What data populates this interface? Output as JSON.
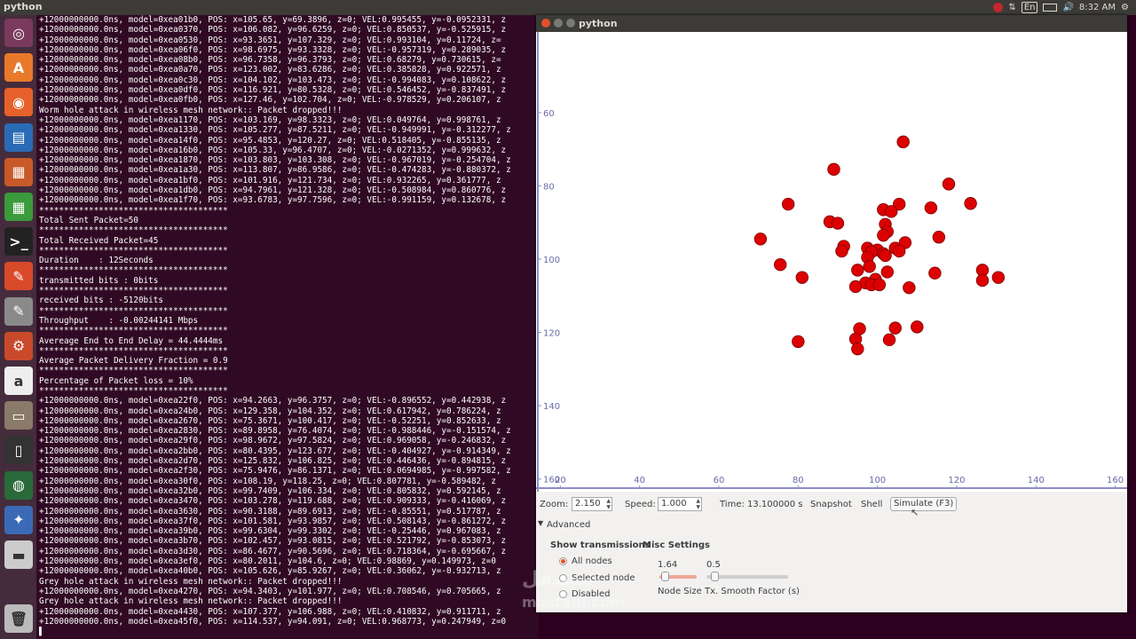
{
  "topbar": {
    "title": "python",
    "lang": "En",
    "time": "8:32 AM"
  },
  "launcher": {
    "items": [
      {
        "name": "ubuntu-dash-icon",
        "color": "#7a3a5e",
        "glyph": "◎"
      },
      {
        "name": "software-center-icon",
        "color": "#e9792a",
        "glyph": "A"
      },
      {
        "name": "firefox-icon",
        "color": "#e6612b",
        "glyph": "◉"
      },
      {
        "name": "writer-icon",
        "color": "#2a6bb5",
        "glyph": "▤"
      },
      {
        "name": "impress-icon",
        "color": "#c85a2a",
        "glyph": "▦"
      },
      {
        "name": "calc-icon",
        "color": "#3b9a3b",
        "glyph": "▦"
      },
      {
        "name": "terminal-icon",
        "color": "#222222",
        "glyph": ">_"
      },
      {
        "name": "editor-icon",
        "color": "#d84a2a",
        "glyph": "✎"
      },
      {
        "name": "text-editor-icon",
        "color": "#8a8a8a",
        "glyph": "✎"
      },
      {
        "name": "settings-icon",
        "color": "#c94a2a",
        "glyph": "⚙"
      },
      {
        "name": "amazon-icon",
        "color": "#eeeeee",
        "glyph": "a"
      },
      {
        "name": "files-icon",
        "color": "#8a7a6a",
        "glyph": "▭"
      },
      {
        "name": "usb-icon",
        "color": "#333333",
        "glyph": "▯"
      },
      {
        "name": "globe-icon",
        "color": "#2a6a3a",
        "glyph": "◍"
      },
      {
        "name": "python-icon",
        "color": "#3a6ab5",
        "glyph": "✦"
      },
      {
        "name": "drive-icon",
        "color": "#cccccc",
        "glyph": "▬"
      }
    ],
    "trash": {
      "name": "trash-icon",
      "color": "#bbbbbb",
      "glyph": "🗑"
    }
  },
  "terminal": {
    "lines": [
      "+12000000000.0ns, model=0xea01b0, POS: x=105.65, y=69.3896, z=0; VEL:0.995455, y=-0.0952331, z",
      "+12000000000.0ns, model=0xea0370, POS: x=106.082, y=96.6259, z=0; VEL:0.850537, y=-0.525915, z",
      "+12000000000.0ns, model=0xea0530, POS: x=93.3651, y=107.329, z=0; VEL:0.993104, y=0.11724, z=",
      "+12000000000.0ns, model=0xea06f0, POS: x=98.6975, y=93.3328, z=0; VEL:-0.957319, y=0.289035, z",
      "+12000000000.0ns, model=0xea08b0, POS: x=96.7358, y=96.3793, z=0; VEL:0.68279, y=0.730615, z=",
      "+12000000000.0ns, model=0xea0a70, POS: x=123.002, y=83.6286, z=0; VEL:0.385828, y=0.922571, z",
      "+12000000000.0ns, model=0xea0c30, POS: x=104.102, y=103.473, z=0; VEL:-0.994083, y=0.108622, z",
      "+12000000000.0ns, model=0xea0df0, POS: x=116.921, y=80.5328, z=0; VEL:0.546452, y=-0.837491, z",
      "+12000000000.0ns, model=0xea0fb0, POS: x=127.46, y=102.704, z=0; VEL:-0.978529, y=0.206107, z",
      "Worm hole attack in wireless mesh network:: Packet dropped!!!",
      "+12000000000.0ns, model=0xea1170, POS: x=103.169, y=98.3323, z=0; VEL:0.049764, y=0.998761, z",
      "+12000000000.0ns, model=0xea1330, POS: x=105.277, y=87.5211, z=0; VEL:-0.949991, y=-0.312277, z",
      "+12000000000.0ns, model=0xea14f0, POS: x=95.4853, y=120.27, z=0; VEL:0.518405, y=-0.855135, z",
      "+12000000000.0ns, model=0xea16b0, POS: x=105.33, y=96.4707, z=0; VEL:-0.0271352, y=0.999632, z",
      "+12000000000.0ns, model=0xea1870, POS: x=103.803, y=103.308, z=0; VEL:-0.967019, y=-0.254704, z",
      "+12000000000.0ns, model=0xea1a30, POS: x=113.807, y=86.9586, z=0; VEL:-0.474283, y=-0.880372, z",
      "+12000000000.0ns, model=0xea1bf0, POS: x=101.916, y=121.734, z=0; VEL:0.932265, y=0.361777, z",
      "+12000000000.0ns, model=0xea1db0, POS: x=94.7961, y=121.328, z=0; VEL:-0.508984, y=0.860776, z",
      "+12000000000.0ns, model=0xea1f70, POS: x=93.6783, y=97.7596, z=0; VEL:-0.991159, y=0.132678, z",
      "**************************************",
      "Total Sent Packet=50",
      "**************************************",
      "Total Received Packet=45",
      "**************************************",
      "Duration    : 12Seconds",
      "**************************************",
      "transmitted bits : 0bits",
      "**************************************",
      "received bits : -5120bits",
      "**************************************",
      "Throughput    : -0.00244141 Mbps",
      "**************************************",
      "Avereage End to End Delay = 44.4444ms",
      "**************************************",
      "Average Packet Delivery Fraction = 0.9",
      "**************************************",
      "Percentage of Packet loss = 10%",
      "**************************************",
      "+12000000000.0ns, model=0xea22f0, POS: x=94.2663, y=96.3757, z=0; VEL:-0.896552, y=0.442938, z",
      "+12000000000.0ns, model=0xea24b0, POS: x=129.358, y=104.352, z=0; VEL:0.617942, y=0.786224, z",
      "+12000000000.0ns, model=0xea2670, POS: x=75.3671, y=100.417, z=0; VEL:-0.52251, y=0.852633, z",
      "+12000000000.0ns, model=0xea2830, POS: x=89.8958, y=76.4074, z=0; VEL:-0.988446, y=-0.151574, z",
      "+12000000000.0ns, model=0xea29f0, POS: x=98.9672, y=97.5824, z=0; VEL:0.969058, y=-0.246832, z",
      "+12000000000.0ns, model=0xea2bb0, POS: x=80.4395, y=123.677, z=0; VEL:-0.404927, y=-0.914349, z",
      "+12000000000.0ns, model=0xea2d70, POS: x=125.832, y=106.825, z=0; VEL:0.446436, y=-0.894815, z",
      "+12000000000.0ns, model=0xea2f30, POS: x=75.9476, y=86.1371, z=0; VEL:0.0694985, y=-0.997582, z",
      "+12000000000.0ns, model=0xea30f0, POS: x=108.19, y=118.25, z=0; VEL:0.807781, y=-0.589482, z",
      "+12000000000.0ns, model=0xea32b0, POS: x=99.7409, y=106.334, z=0; VEL:0.805832, y=0.592145, z",
      "+12000000000.0ns, model=0xea3470, POS: x=103.278, y=119.688, z=0; VEL:0.909333, y=-0.416069, z",
      "+12000000000.0ns, model=0xea3630, POS: x=90.3188, y=89.6913, z=0; VEL:-0.85551, y=0.517787, z",
      "+12000000000.0ns, model=0xea37f0, POS: x=101.581, y=93.9857, z=0; VEL:0.508143, y=-0.861272, z",
      "+12000000000.0ns, model=0xea39b0, POS: x=99.6304, y=99.3302, z=0; VEL:-0.25446, y=0.967083, z",
      "+12000000000.0ns, model=0xea3b70, POS: x=102.457, y=93.0815, z=0; VEL:0.521792, y=-0.853073, z",
      "+12000000000.0ns, model=0xea3d30, POS: x=86.4677, y=90.5696, z=0; VEL:0.718364, y=-0.695667, z",
      "+12000000000.0ns, model=0xea3ef0, POS: x=80.2011, y=104.6, z=0; VEL:0.98869, y=0.149973, z=0",
      "+12000000000.0ns, model=0xea40b0, POS: x=105.626, y=85.9267, z=0; VEL:0.36062, y=-0.932713, z",
      "Grey hole attack in wireless mesh network:: Packet dropped!!!",
      "+12000000000.0ns, model=0xea4270, POS: x=94.3403, y=101.977, z=0; VEL:0.708546, y=0.705665, z",
      "Grey hole attack in wireless mesh network:: Packet dropped!!!",
      "+12000000000.0ns, model=0xea4430, POS: x=107.377, y=106.988, z=0; VEL:0.410832, y=0.911711, z",
      "+12000000000.0ns, model=0xea45f0, POS: x=114.537, y=94.091, z=0; VEL:0.968773, y=0.247949, z=0"
    ],
    "cursor": "▌"
  },
  "pywin": {
    "title": "python"
  },
  "chart_data": {
    "type": "scatter",
    "title": "",
    "xlabel": "",
    "ylabel": "",
    "xlim": [
      15,
      163
    ],
    "ylim": [
      38,
      162
    ],
    "x_ticks": [
      "20",
      "40",
      "60",
      "80",
      "100",
      "120",
      "140",
      "160"
    ],
    "x_tick_values": [
      20,
      40,
      60,
      80,
      100,
      120,
      140,
      160
    ],
    "y_ticks": [
      "60",
      "80",
      "100",
      "120",
      "140",
      "160"
    ],
    "y_tick_values": [
      60,
      80,
      100,
      120,
      140,
      160
    ],
    "y_inverted": true,
    "grid": false,
    "node_color": "#dd0000",
    "points": [
      [
        106.5,
        68.0
      ],
      [
        89.0,
        75.5
      ],
      [
        118.0,
        79.5
      ],
      [
        123.5,
        84.8
      ],
      [
        77.5,
        85.0
      ],
      [
        105.5,
        85.0
      ],
      [
        113.5,
        86.0
      ],
      [
        101.5,
        86.5
      ],
      [
        103.5,
        87.0
      ],
      [
        88.0,
        89.8
      ],
      [
        90.0,
        90.2
      ],
      [
        102.0,
        90.5
      ],
      [
        102.5,
        92.5
      ],
      [
        101.5,
        93.5
      ],
      [
        115.5,
        94.0
      ],
      [
        70.5,
        94.5
      ],
      [
        107.0,
        95.5
      ],
      [
        91.5,
        96.5
      ],
      [
        97.5,
        97.0
      ],
      [
        100.0,
        97.5
      ],
      [
        104.5,
        97.0
      ],
      [
        91.0,
        97.8
      ],
      [
        105.5,
        97.8
      ],
      [
        98.5,
        98.0
      ],
      [
        101.5,
        98.5
      ],
      [
        97.5,
        99.5
      ],
      [
        102.0,
        99.0
      ],
      [
        75.5,
        101.5
      ],
      [
        98.0,
        102.0
      ],
      [
        95.0,
        103.0
      ],
      [
        102.5,
        103.5
      ],
      [
        126.5,
        103.0
      ],
      [
        114.5,
        103.8
      ],
      [
        130.5,
        105.0
      ],
      [
        81.0,
        105.0
      ],
      [
        99.5,
        105.5
      ],
      [
        126.5,
        105.8
      ],
      [
        97.0,
        106.5
      ],
      [
        98.5,
        107.0
      ],
      [
        100.5,
        107.0
      ],
      [
        94.5,
        107.5
      ],
      [
        108.0,
        107.8
      ],
      [
        95.5,
        119.0
      ],
      [
        104.5,
        118.8
      ],
      [
        110.0,
        118.5
      ],
      [
        94.5,
        121.8
      ],
      [
        103.0,
        122.0
      ],
      [
        80.0,
        122.5
      ],
      [
        95.0,
        124.5
      ]
    ]
  },
  "controls": {
    "zoom_label": "Zoom:",
    "zoom_value": "2.150",
    "speed_label": "Speed:",
    "speed_value": "1.000",
    "time_text": "Time: 13.100000 s",
    "snapshot_label": "Snapshot",
    "shell_label": "Shell",
    "simulate_label": "Simulate (F3)",
    "advanced_label": "Advanced",
    "show_transmissions_label": "Show transmissions",
    "misc_settings_label": "Misc Settings",
    "radio_all": "All nodes",
    "radio_selected": "Selected node",
    "radio_disabled": "Disabled",
    "node_size_value": "1.64",
    "node_size_label": "Node Size",
    "node_size_level": 0.05,
    "smooth_value": "0.5",
    "smooth_label": "Tx. Smooth Factor (s)",
    "smooth_level": 0.05
  },
  "watermark": "مستقل mostaql.com"
}
